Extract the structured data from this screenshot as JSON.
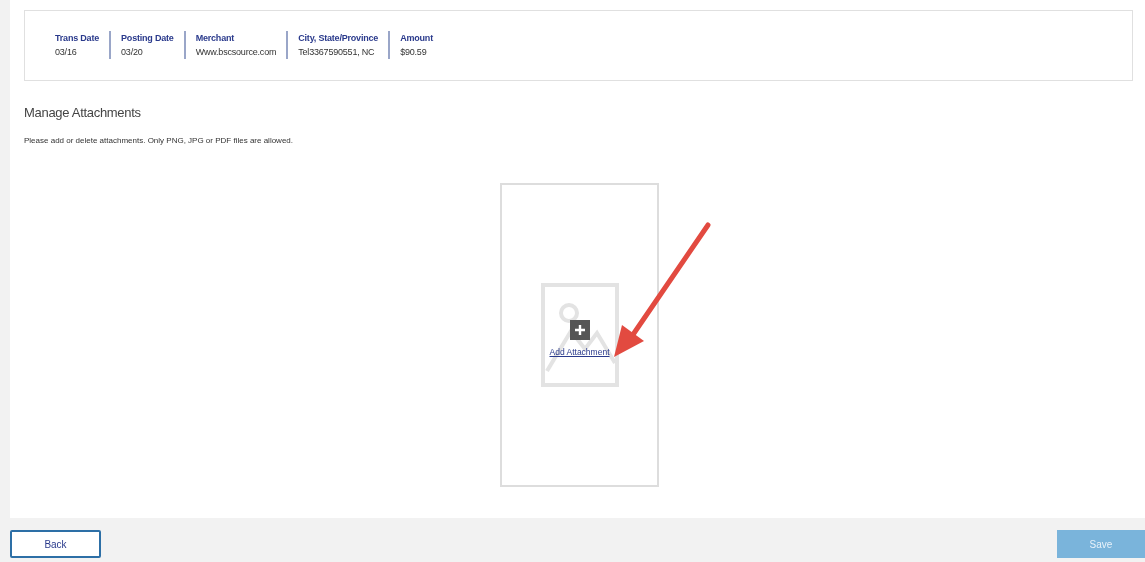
{
  "transaction": [
    {
      "label": "Trans Date",
      "value": "03/16"
    },
    {
      "label": "Posting Date",
      "value": "03/20"
    },
    {
      "label": "Merchant",
      "value": "Www.bscsource.com"
    },
    {
      "label": "City, State/Province",
      "value": "Tel3367590551, NC"
    },
    {
      "label": "Amount",
      "value": "$90.59"
    }
  ],
  "attachments": {
    "title": "Manage Attachments",
    "description": "Please add or delete attachments. Only PNG, JPG or PDF files are allowed.",
    "add_link": "Add Attachment"
  },
  "footer": {
    "buttons": [
      {
        "label": "Back",
        "kind": "secondary",
        "disabled": false
      },
      {
        "label": "Save",
        "kind": "primary",
        "disabled": true
      }
    ]
  }
}
